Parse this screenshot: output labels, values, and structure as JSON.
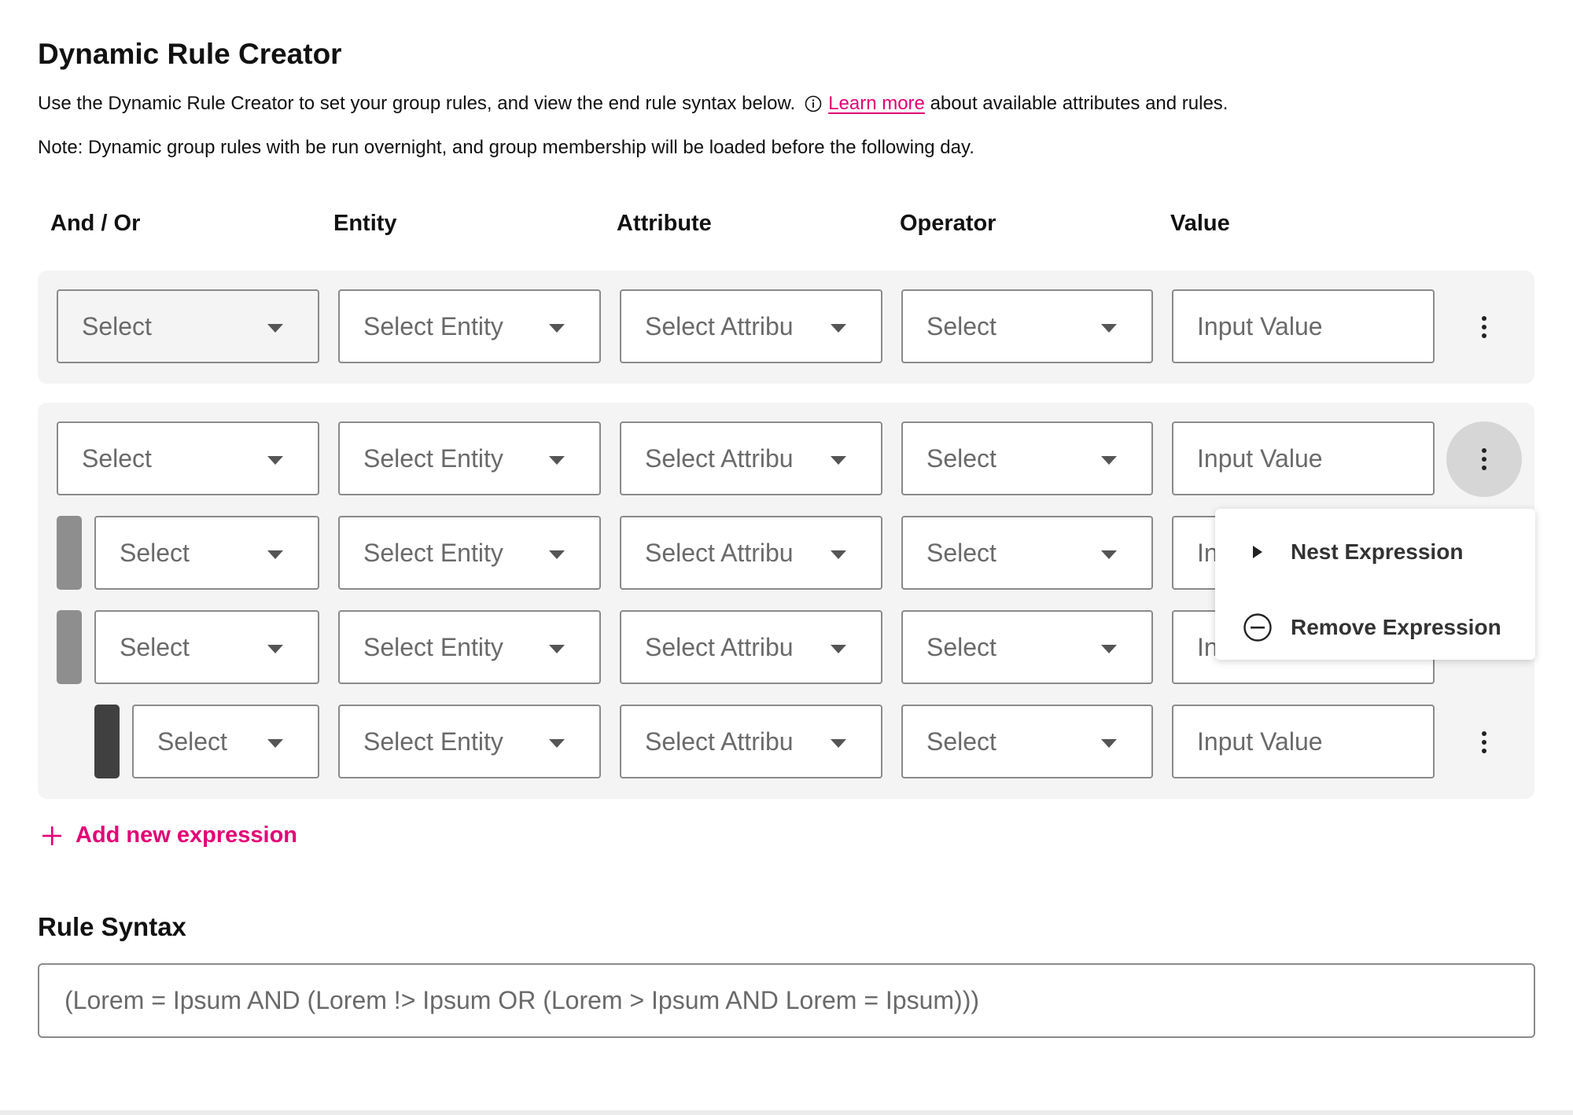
{
  "page": {
    "title": "Dynamic Rule Creator",
    "description_before": "Use the Dynamic Rule Creator to set your group rules, and view the end rule syntax below.",
    "learn_more": "Learn more",
    "description_after": "about available attributes and rules.",
    "note": "Note: Dynamic group rules with be run overnight, and group membership will be loaded before the following day."
  },
  "columns": {
    "and_or": "And / Or",
    "entity": "Entity",
    "attribute": "Attribute",
    "operator": "Operator",
    "value": "Value"
  },
  "rows": [
    {
      "and_or": "Select",
      "entity": "Select Entity",
      "attribute": "Select Attribu",
      "operator": "Select",
      "value": "Input Value"
    },
    {
      "and_or": "Select",
      "entity": "Select Entity",
      "attribute": "Select Attribu",
      "operator": "Select",
      "value": "Input Value"
    },
    {
      "and_or": "Select",
      "entity": "Select Entity",
      "attribute": "Select Attribu",
      "operator": "Select",
      "value": "In"
    },
    {
      "and_or": "Select",
      "entity": "Select Entity",
      "attribute": "Select Attribu",
      "operator": "Select",
      "value": "In"
    },
    {
      "and_or": "Select",
      "entity": "Select Entity",
      "attribute": "Select Attribu",
      "operator": "Select",
      "value": "Input Value"
    }
  ],
  "context_menu": {
    "nest": "Nest Expression",
    "remove": "Remove Expression"
  },
  "add_expression": "Add new expression",
  "rule_syntax": {
    "title": "Rule Syntax",
    "value": "(Lorem = Ipsum AND (Lorem !> Ipsum OR (Lorem > Ipsum AND Lorem = Ipsum)))"
  },
  "colors": {
    "accent": "#e20074",
    "group_bg": "#f4f4f4",
    "nest_bar": "#8e8e8e",
    "nest_bar_dark": "#404040"
  },
  "icons": [
    "info-icon",
    "chevron-down-icon",
    "kebab-icon",
    "caret-right-icon",
    "minus-circle-icon",
    "plus-icon"
  ]
}
